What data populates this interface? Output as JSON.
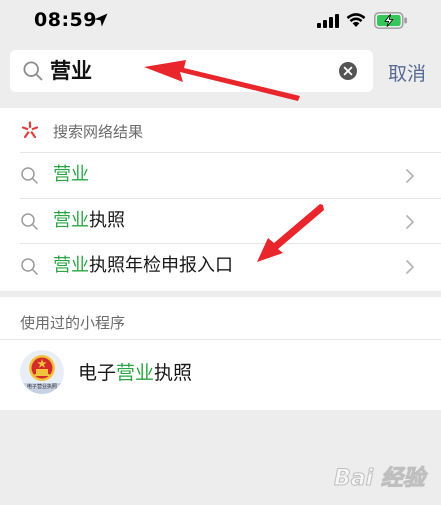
{
  "status_bar": {
    "time": "08:59"
  },
  "search": {
    "query": "营业",
    "cancel_label": "取消"
  },
  "web_results": {
    "section_title": "搜索网络结果",
    "items": [
      {
        "highlight": "营业",
        "rest": ""
      },
      {
        "highlight": "营业",
        "rest": "执照"
      },
      {
        "highlight": "营业",
        "rest": "执照年检申报入口"
      }
    ]
  },
  "mini_programs": {
    "section_title": "使用过的小程序",
    "items": [
      {
        "prefix": "电子",
        "highlight": "营业",
        "suffix": "执照",
        "icon_caption": "电子营业执照"
      }
    ]
  },
  "watermark": {
    "text": "Bai 经验"
  },
  "colors": {
    "page_bg": "#ededed",
    "highlight": "#2aa644",
    "link": "#576b95",
    "arrow": "#e8262b",
    "emblem_red": "#d32a2a",
    "emblem_gold": "#f2c23c"
  },
  "icons": [
    "location-arrow-icon",
    "signal-icon",
    "wifi-icon",
    "battery-charging-icon",
    "search-icon",
    "clear-icon",
    "web-search-icon",
    "chevron-right-icon",
    "national-emblem-icon"
  ]
}
